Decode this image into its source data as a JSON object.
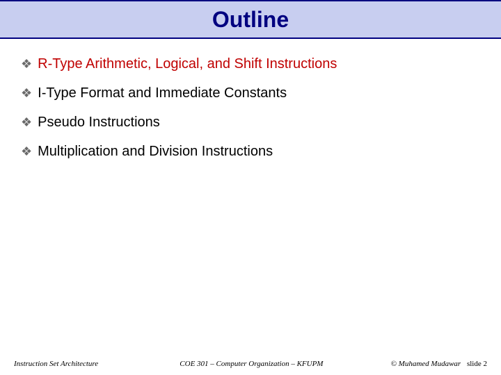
{
  "title": "Outline",
  "bullets": [
    {
      "text": "R-Type Arithmetic, Logical, and Shift Instructions",
      "highlight": true
    },
    {
      "text": "I-Type Format and Immediate Constants",
      "highlight": false
    },
    {
      "text": "Pseudo Instructions",
      "highlight": false
    },
    {
      "text": "Multiplication and Division Instructions",
      "highlight": false
    }
  ],
  "footer": {
    "left": "Instruction Set Architecture",
    "center": "COE 301 – Computer Organization – KFUPM",
    "copyright": "© Muhamed Mudawar",
    "slide": "slide 2"
  }
}
